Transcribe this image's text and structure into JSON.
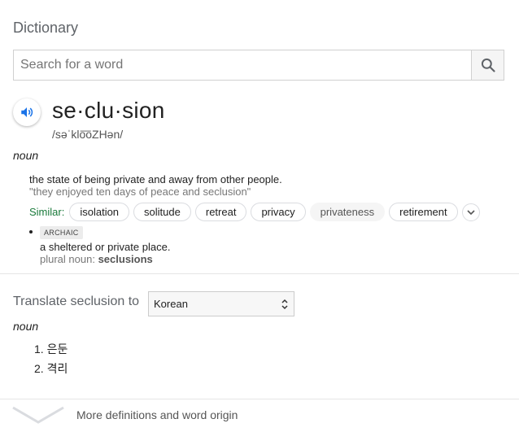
{
  "title": "Dictionary",
  "search": {
    "placeholder": "Search for a word"
  },
  "entry": {
    "headword": "se·clu·sion",
    "phonetic": "/səˈklo͞oZHən/",
    "pos": "noun",
    "definition": "the state of being private and away from other people.",
    "example": "\"they enjoyed ten days of peace and seclusion\"",
    "similar_label": "Similar:",
    "similar": [
      "isolation",
      "solitude",
      "retreat",
      "privacy",
      "privateness",
      "retirement"
    ],
    "sense2": {
      "tag": "ARCHAIC",
      "definition": "a sheltered or private place.",
      "plural_label": "plural noun:",
      "plural": "seclusions"
    }
  },
  "translate": {
    "label": "Translate seclusion to",
    "language": "Korean",
    "pos": "noun",
    "items": [
      "1. 은둔",
      "2. 격리"
    ]
  },
  "more": {
    "label": "More definitions and word origin"
  }
}
